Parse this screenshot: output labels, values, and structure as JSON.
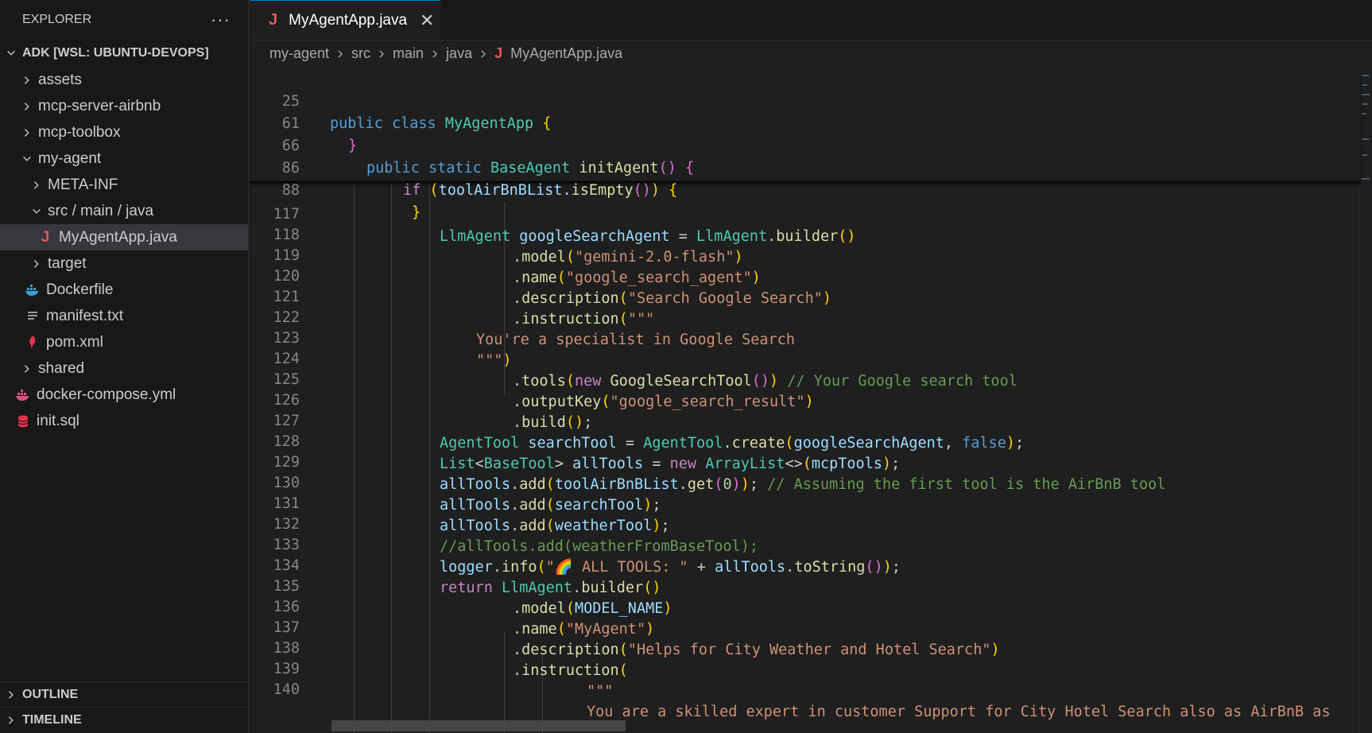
{
  "sidebar": {
    "title": "EXPLORER",
    "more": "···",
    "root": "ADK [WSL: UBUNTU-DEVOPS]",
    "items": [
      {
        "label": "assets"
      },
      {
        "label": "mcp-server-airbnb"
      },
      {
        "label": "mcp-toolbox"
      },
      {
        "label": "my-agent"
      },
      {
        "label": "META-INF"
      },
      {
        "label": "src / main / java"
      },
      {
        "label": "MyAgentApp.java",
        "icon": "J"
      },
      {
        "label": "target"
      },
      {
        "label": "Dockerfile"
      },
      {
        "label": "manifest.txt"
      },
      {
        "label": "pom.xml"
      },
      {
        "label": "shared"
      },
      {
        "label": "docker-compose.yml"
      },
      {
        "label": "init.sql"
      }
    ],
    "outline": "OUTLINE",
    "timeline": "TIMELINE"
  },
  "tab": {
    "label": "MyAgentApp.java",
    "icon": "J",
    "close": "✕"
  },
  "breadcrumb": [
    "my-agent",
    "src",
    "main",
    "java",
    "MyAgentApp.java"
  ],
  "line_numbers": {
    "sticky": [
      "25",
      "61",
      "66",
      "86",
      "88"
    ],
    "body": [
      "117",
      "118",
      "119",
      "120",
      "121",
      "122",
      "123",
      "124",
      "125",
      "126",
      "127",
      "128",
      "129",
      "130",
      "131",
      "132",
      "133",
      "134",
      "135",
      "136",
      "137",
      "138",
      "139",
      "140"
    ]
  },
  "code": {
    "l25": [
      "public",
      " ",
      "class",
      " ",
      "MyAgentApp",
      " ",
      "{"
    ],
    "l61": [
      "}"
    ],
    "l66": [
      "public",
      " ",
      "static",
      " ",
      "BaseAgent",
      " ",
      "initAgent",
      "(",
      ")",
      " ",
      "{"
    ],
    "l86": [
      "if",
      " ",
      "(",
      "toolAirBnBList",
      ".",
      "isEmpty",
      "(",
      ")",
      ")",
      " ",
      "{"
    ],
    "l88": [
      "}"
    ],
    "l117": [
      "LlmAgent",
      " ",
      "googleSearchAgent",
      " = ",
      "LlmAgent",
      ".",
      "builder",
      "(",
      ")"
    ],
    "l118": [
      ".",
      "model",
      "(",
      "\"gemini-2.0-flash\"",
      ")"
    ],
    "l119": [
      ".",
      "name",
      "(",
      "\"google_search_agent\"",
      ")"
    ],
    "l120": [
      ".",
      "description",
      "(",
      "\"Search Google Search\"",
      ")"
    ],
    "l121": [
      ".",
      "instruction",
      "(",
      "\"\"\""
    ],
    "l122": [
      "You're a specialist in Google Search"
    ],
    "l123": [
      "\"\"\"",
      ")"
    ],
    "l124": [
      ".",
      "tools",
      "(",
      "new",
      " ",
      "GoogleSearchTool",
      "(",
      ")",
      ")",
      " ",
      "// Your Google search tool"
    ],
    "l125": [
      ".",
      "outputKey",
      "(",
      "\"google_search_result\"",
      ")"
    ],
    "l126": [
      ".",
      "build",
      "(",
      ")",
      ";"
    ],
    "l127": [
      "AgentTool",
      " ",
      "searchTool",
      " = ",
      "AgentTool",
      ".",
      "create",
      "(",
      "googleSearchAgent",
      ", ",
      "false",
      ")",
      ";"
    ],
    "l128": [
      "List",
      "<",
      "BaseTool",
      "> ",
      "allTools",
      " = ",
      "new",
      " ",
      "ArrayList",
      "<>",
      "(",
      "mcpTools",
      ")",
      ";"
    ],
    "l129": [
      "allTools",
      ".",
      "add",
      "(",
      "toolAirBnBList",
      ".",
      "get",
      "(",
      "0",
      ")",
      ")",
      "; ",
      "// Assuming the first tool is the AirBnB tool"
    ],
    "l130": [
      "allTools",
      ".",
      "add",
      "(",
      "searchTool",
      ")",
      ";"
    ],
    "l131": [
      "allTools",
      ".",
      "add",
      "(",
      "weatherTool",
      ")",
      ";"
    ],
    "l132": [
      "//allTools.add(weatherFromBaseTool);"
    ],
    "l133": [
      "logger",
      ".",
      "info",
      "(",
      "\"🌈 ALL TOOLS: \"",
      " + ",
      "allTools",
      ".",
      "toString",
      "(",
      ")",
      ")",
      ";"
    ],
    "l134": [
      "return",
      " ",
      "LlmAgent",
      ".",
      "builder",
      "(",
      ")"
    ],
    "l135": [
      ".",
      "model",
      "(",
      "MODEL_NAME",
      ")"
    ],
    "l136": [
      ".",
      "name",
      "(",
      "\"MyAgent\"",
      ")"
    ],
    "l137": [
      ".",
      "description",
      "(",
      "\"Helps for City Weather and Hotel Search\"",
      ")"
    ],
    "l138": [
      ".",
      "instruction",
      "("
    ],
    "l139": [
      "\"\"\""
    ],
    "l140": [
      "You are a skilled expert in customer Support for City Hotel Search also as AirBnB as"
    ]
  }
}
